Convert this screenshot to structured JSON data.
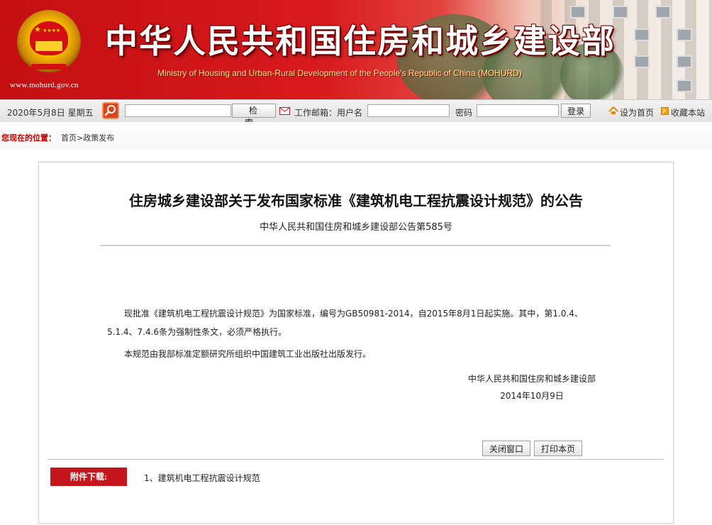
{
  "header": {
    "site_title": "中华人民共和国住房和城乡建设部",
    "site_title_en": "Ministry of Housing and Urban-Rural Development of the People's Republic of China (MOHURD)",
    "site_url": "www.mohurd.gov.cn"
  },
  "toolbar": {
    "date": "2020年5月8日 星期五",
    "search_value": "",
    "search_button": "检索",
    "mail_label": "工作邮箱：用户名",
    "username_value": "",
    "password_label": "密码",
    "password_value": "",
    "login_button": "登录",
    "set_home": "设为首页",
    "bookmark": "收藏本站"
  },
  "breadcrumb": {
    "label": "您现在的位置：",
    "path": "首页>政策发布"
  },
  "article": {
    "title": "住房城乡建设部关于发布国家标准《建筑机电工程抗震设计规范》的公告",
    "subtitle": "中华人民共和国住房和城乡建设部公告第585号",
    "paragraphs": [
      "现批准《建筑机电工程抗震设计规范》为国家标准，编号为GB50981-2014，自2015年8月1日起实施。其中，第1.0.4、5.1.4、7.4.6条为强制性条文，必须严格执行。",
      "本规范由我部标准定额研究所组织中国建筑工业出版社出版发行。"
    ],
    "signature_org": "中华人民共和国住房和城乡建设部",
    "signature_date": "2014年10月9日",
    "close_button": "关闭窗口",
    "print_button": "打印本页",
    "attachment_label": "附件下载:",
    "attachments": [
      "1、建筑机电工程抗震设计规范"
    ]
  },
  "colors": {
    "banner_red": "#c40f12",
    "accent_red": "#c4161c",
    "breadcrumb_red": "#c00000"
  },
  "icons": [
    "search-icon",
    "mail-icon",
    "home-icon",
    "bookmark-icon"
  ]
}
